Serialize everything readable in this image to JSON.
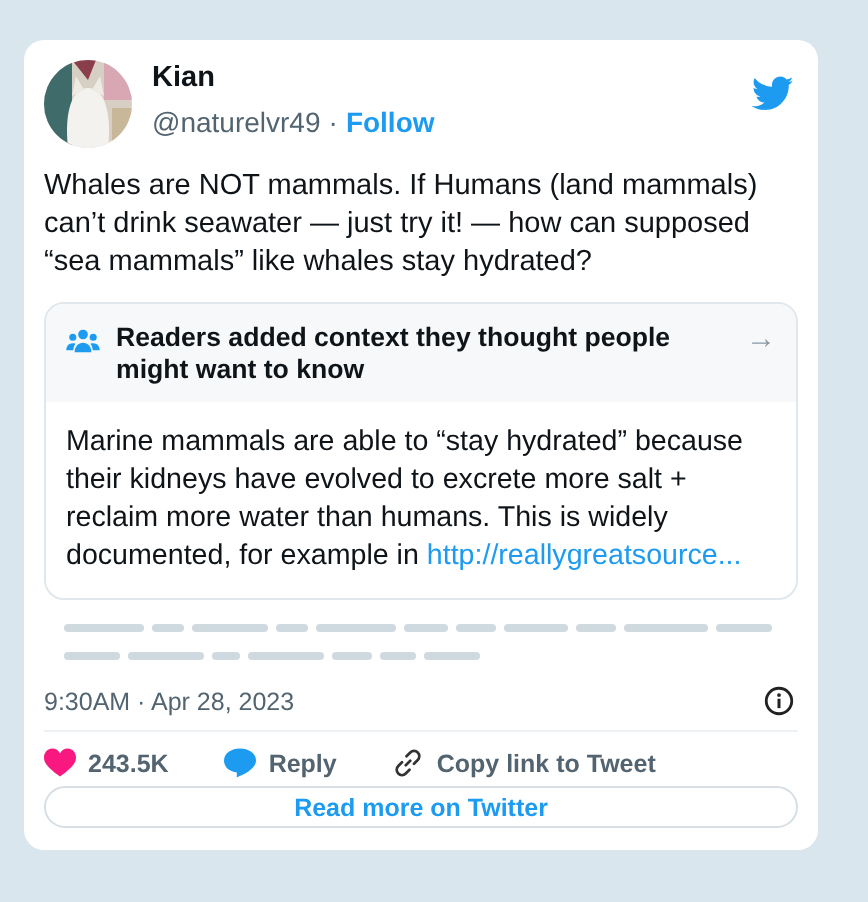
{
  "author": {
    "name": "Kian",
    "handle": "@naturelvr49",
    "separator": "·",
    "follow": "Follow"
  },
  "tweet_text": "Whales are NOT mammals. If Humans (land mammals) can’t drink seawater — just try it! — how can supposed “sea mammals” like whales stay hydrated?",
  "context_note": {
    "heading": "Readers added context they thought people might want to know",
    "arrow": "→",
    "body": "Marine mammals are able to “stay hydrated” because their kidneys have evolved to excrete more salt + reclaim more water than humans. This is widely documented, for example in",
    "link": "http://reallygreatsource..."
  },
  "timestamp": "9:30AM · Apr 28, 2023",
  "actions": [
    {
      "kind": "like",
      "label": "243.5K"
    },
    {
      "kind": "reply",
      "label": "Reply"
    },
    {
      "kind": "copy",
      "label": "Copy link to Tweet"
    }
  ],
  "read_more": "Read more on Twitter"
}
